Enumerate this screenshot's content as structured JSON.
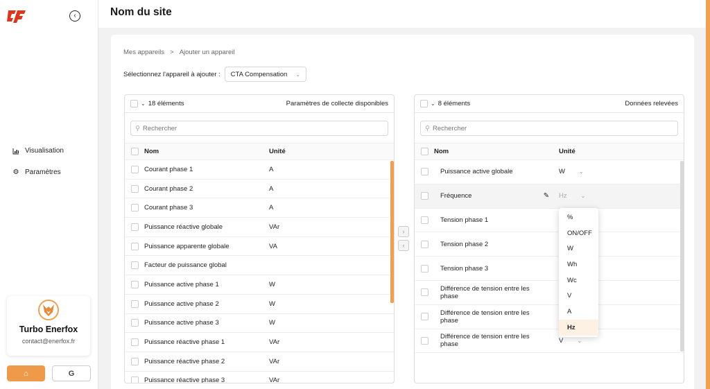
{
  "sidebar": {
    "nav": [
      {
        "label": "Visualisation",
        "icon": "chart-icon"
      },
      {
        "label": "Paramètres",
        "icon": "gear-icon"
      }
    ],
    "user": {
      "name": "Turbo Enerfox",
      "email": "contact@enerfox.fr"
    }
  },
  "header": {
    "title": "Nom du site"
  },
  "breadcrumb": [
    "Mes appareils",
    ">",
    "Ajouter un appareil"
  ],
  "device_select": {
    "label": "Sélectionnez l'appareil à ajouter :",
    "value": "CTA Compensation"
  },
  "left_panel": {
    "count": "18 éléments",
    "title": "Paramètres de collecte disponibles",
    "search_placeholder": "Rechercher",
    "col_name": "Nom",
    "col_unit": "Unité",
    "rows": [
      {
        "name": "Courant phase 1",
        "unit": "A"
      },
      {
        "name": "Courant phase 2",
        "unit": "A"
      },
      {
        "name": "Courant phase 3",
        "unit": "A"
      },
      {
        "name": "Puissance réactive globale",
        "unit": "VAr"
      },
      {
        "name": "Puissance apparente globale",
        "unit": "VA"
      },
      {
        "name": "Facteur de puissance global",
        "unit": ""
      },
      {
        "name": "Puissance active phase 1",
        "unit": "W"
      },
      {
        "name": "Puissance active phase 2",
        "unit": "W"
      },
      {
        "name": "Puissance active phase 3",
        "unit": "W"
      },
      {
        "name": "Puissance réactive phase 1",
        "unit": "VAr"
      },
      {
        "name": "Puissance réactive phase 2",
        "unit": "VAr"
      },
      {
        "name": "Puissance réactive phase 3",
        "unit": "VAr"
      }
    ]
  },
  "right_panel": {
    "count": "8 éléments",
    "title": "Données relevées",
    "search_placeholder": "Rechercher",
    "col_name": "Nom",
    "col_unit": "Unité",
    "rows": [
      {
        "name": "Puissance active globale",
        "unit": "W"
      },
      {
        "name": "Fréquence",
        "unit": "Hz"
      },
      {
        "name": "Tension phase 1",
        "unit": ""
      },
      {
        "name": "Tension phase 2",
        "unit": ""
      },
      {
        "name": "Tension phase 3",
        "unit": ""
      },
      {
        "name": "Différence de tension entre les phase",
        "unit": ""
      },
      {
        "name": "Différence de tension entre les phase",
        "unit": ""
      },
      {
        "name": "Différence de tension entre les phase",
        "unit": "V"
      }
    ]
  },
  "unit_options": [
    "%",
    "ON/OFF",
    "W",
    "Wh",
    "Wc",
    "V",
    "A",
    "Hz"
  ],
  "unit_selected": "Hz",
  "colors": {
    "accent": "#ee9a4a",
    "brand_red": "#d9381e"
  }
}
